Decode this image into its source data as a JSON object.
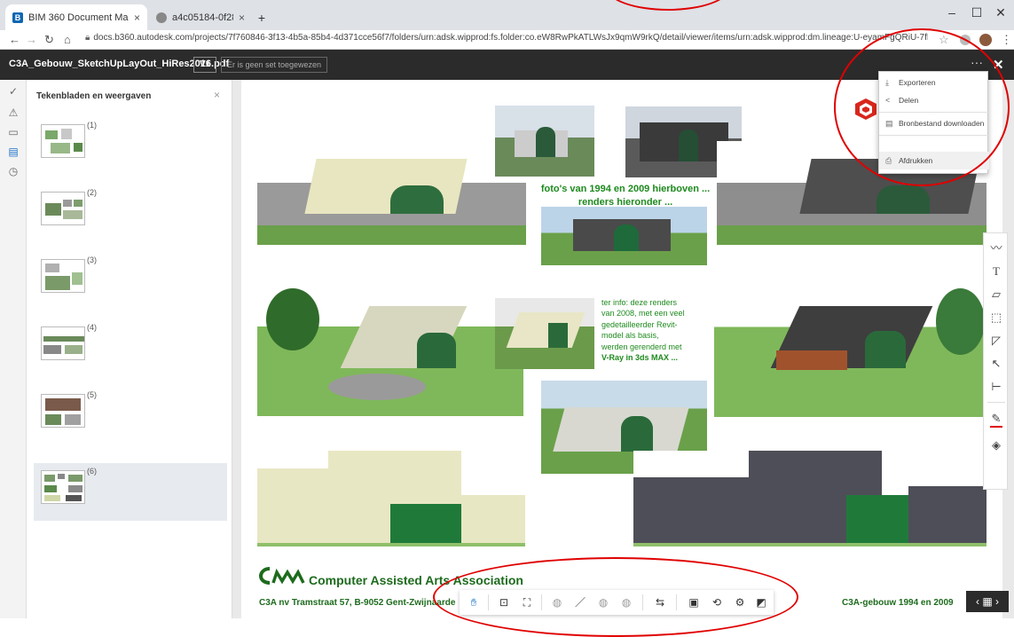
{
  "browser": {
    "tabs": [
      {
        "label": "BIM 360 Document Management",
        "active": true
      },
      {
        "label": "a4c05184-0f28-4f05-aa61-401d",
        "active": false
      }
    ],
    "new_tab": "+",
    "url": "docs.b360.autodesk.com/projects/7f760846-3f13-4b5a-85b4-4d371cce56f7/folders/urn:adsk.wipprod:fs.folder:co.eW8RwPkATLWsJx9qmW9rkQ/detail/viewer/items/urn:adsk.wipprod:dm.lineage:U-eyamFgQRiU-7fFOA06DQ"
  },
  "header": {
    "document_name": "C3A_Gebouw_SketchUpLayOut_HiRes2016.pdf",
    "version": "V1",
    "assignee": "Er is geen set toegewezen"
  },
  "panel": {
    "title": "Tekenbladen en weergaven",
    "sheets": [
      "(1)",
      "(2)",
      "(3)",
      "(4)",
      "(5)",
      "(6)"
    ],
    "selected_index": 5
  },
  "dropdown": {
    "items": [
      {
        "label": "Exporteren",
        "icon": "download-icon"
      },
      {
        "label": "Delen",
        "icon": "share-icon"
      },
      {
        "label": "Bronbestand downloaden",
        "icon": "file-icon"
      },
      {
        "label": "Afdrukken",
        "icon": "print-icon"
      }
    ]
  },
  "document": {
    "caption_line1": "foto's van 1994 en 2009 hierboven ...",
    "caption_line2": "renders hieronder ...",
    "note_line1": "ter info: deze renders",
    "note_line2": "van 2008, met een veel",
    "note_line3": "gedetailleerder Revit-",
    "note_line4": "model als basis,",
    "note_line5": "werden gerenderd met",
    "note_line6": "V-Ray in 3ds MAX ...",
    "association": "Computer Assisted Arts Association",
    "address": "C3A nv Tramstraat 57, B-9052 Gent-Zwijnaarde",
    "address_tail": "u",
    "year_label": "C3A-gebouw 1994 en 2009"
  },
  "bottom_toolbar": {
    "pager": "‹ ▦ ›"
  },
  "colors": {
    "accent_green": "#1e8a1e",
    "highlight_red": "#e00000",
    "header_dark": "#2b2b2b"
  }
}
